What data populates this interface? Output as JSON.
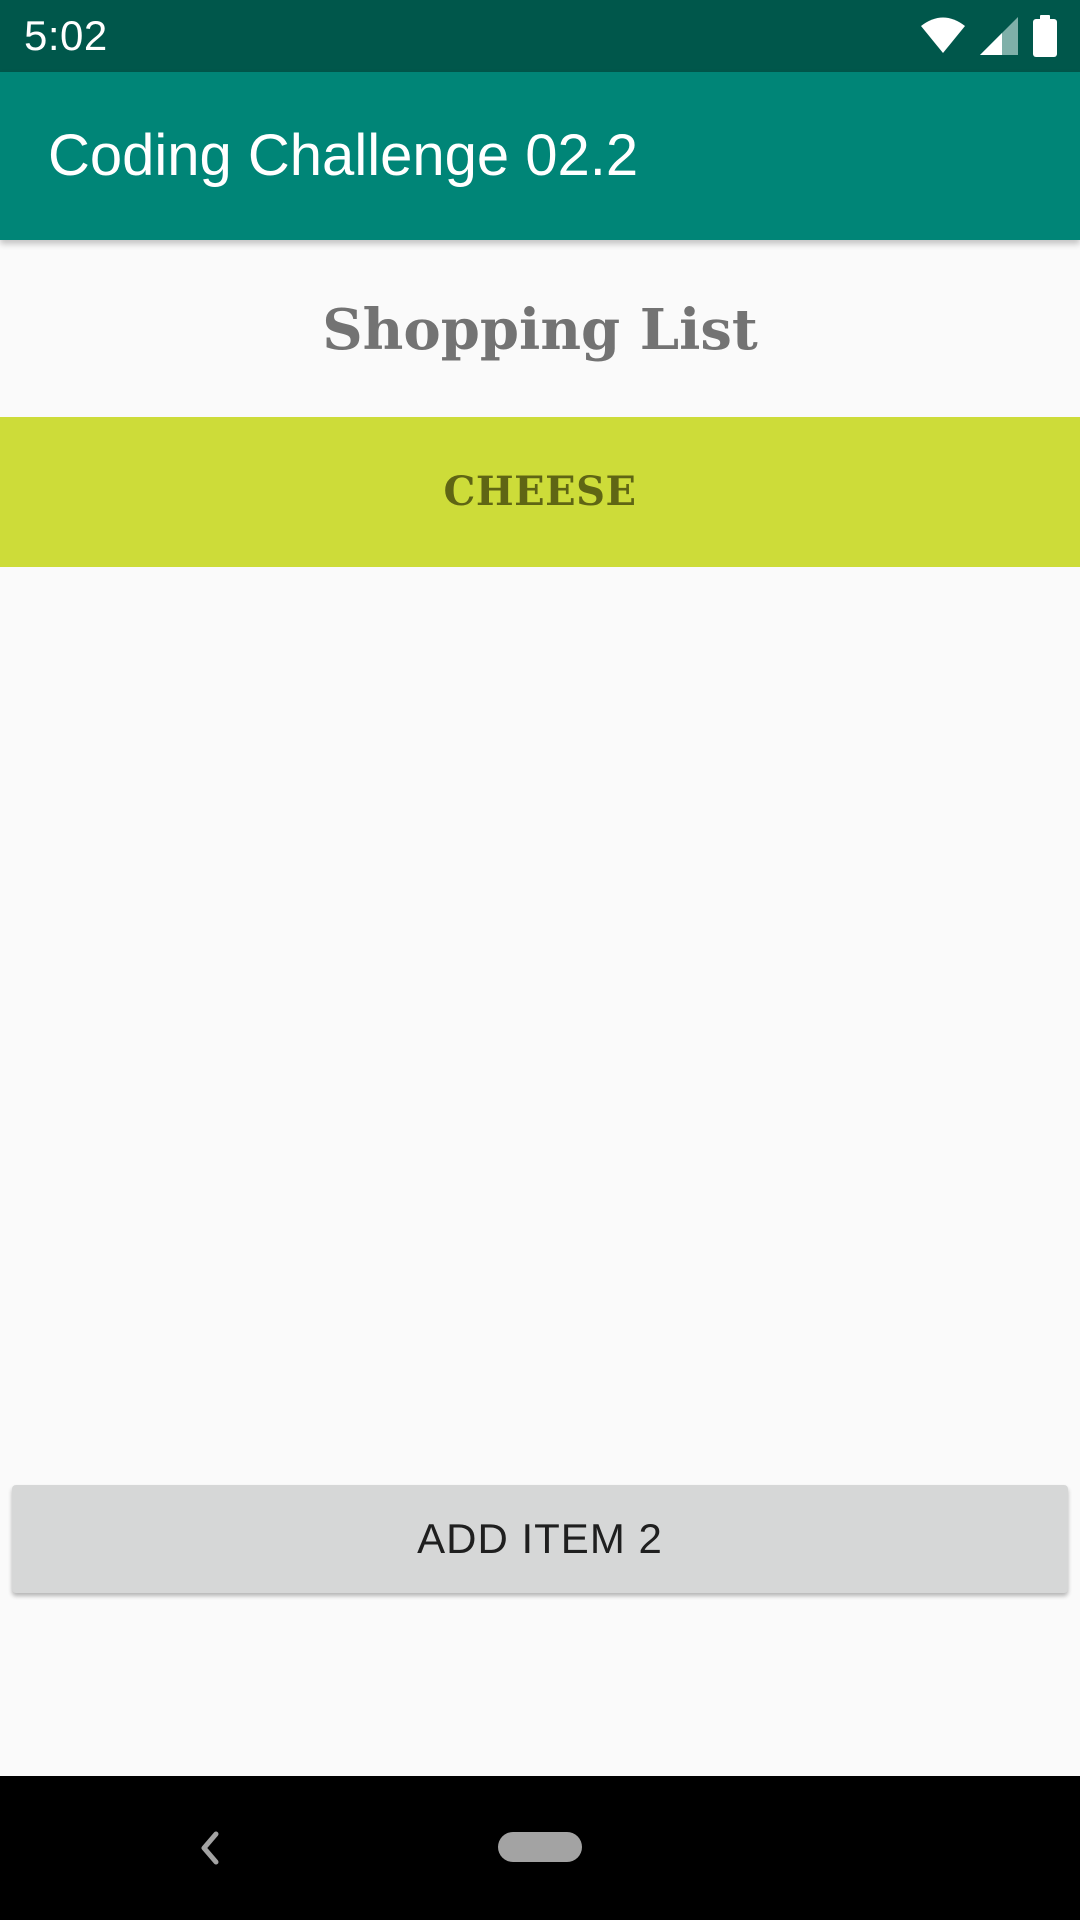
{
  "status_bar": {
    "time": "5:02",
    "icons": [
      "wifi-icon",
      "cellular-signal-icon",
      "battery-icon"
    ],
    "background": "#00574b"
  },
  "app_bar": {
    "title": "Coding Challenge 02.2",
    "background": "#008577"
  },
  "main": {
    "heading": "Shopping List",
    "items": [
      {
        "label": "CHEESE",
        "background": "#cddc39"
      }
    ],
    "add_button_label": "ADD ITEM 2"
  },
  "nav_bar": {
    "icons": [
      "back-icon",
      "home-pill-icon"
    ]
  }
}
